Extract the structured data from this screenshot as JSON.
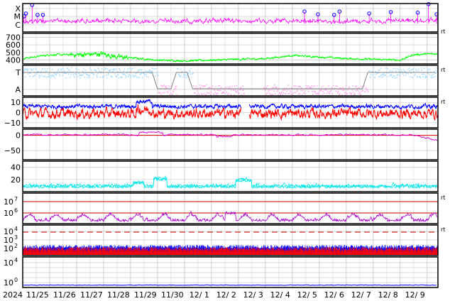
{
  "chart_data": {
    "type": "line",
    "x_axis": {
      "year_label": "2024",
      "dates": [
        "11/25",
        "11/26",
        "11/27",
        "11/28",
        "11/29",
        "11/30",
        "12/ 1",
        "12/ 2",
        "12/ 3",
        "12/ 4",
        "12/ 5",
        "12/ 6",
        "12/ 7",
        "12/ 8",
        "12/ 9"
      ]
    },
    "panels": [
      {
        "id": "xray_flares",
        "type": "line",
        "tick_labels": [
          "X",
          "M",
          "C"
        ],
        "colors": {
          "line": "#ff00ff",
          "markers": "#0000ff"
        },
        "flare_days": [
          0.05,
          0.12,
          0.35,
          0.55,
          0.75,
          10.45,
          10.95,
          11.55,
          11.75,
          12.85,
          13.65,
          14.65,
          15.05,
          15.35
        ],
        "flare_levels": [
          0.55,
          0.65,
          0.95,
          0.6,
          0.6,
          0.72,
          0.62,
          0.6,
          0.72,
          0.65,
          0.7,
          0.68,
          0.98,
          0.62
        ]
      },
      {
        "id": "solar_wind_speed",
        "type": "line",
        "tick_labels": [
          "700",
          "600",
          "500",
          "400"
        ],
        "ylim": [
          350,
          750
        ],
        "colors": {
          "line": "#00ff00"
        },
        "days": [
          0,
          1,
          2,
          3,
          3.5,
          4,
          5,
          6,
          7,
          8,
          9,
          10,
          11,
          12,
          13,
          14,
          14.5,
          15
        ],
        "values": [
          420,
          470,
          470,
          480,
          440,
          430,
          400,
          390,
          400,
          410,
          420,
          460,
          440,
          420,
          410,
          400,
          470,
          480
        ]
      },
      {
        "id": "sector_ta",
        "type": "line",
        "tick_labels": [
          "T",
          "A"
        ],
        "colors": {
          "toward": "#aaddff",
          "away": "#ffaaee",
          "state": "#808080"
        },
        "state_days": [
          0,
          4.8,
          5.0,
          5.5,
          5.7,
          6.1,
          6.3,
          12.6,
          12.8,
          15.3
        ],
        "state_values": [
          1,
          1,
          0,
          0,
          1,
          1,
          0,
          0,
          1,
          1
        ]
      },
      {
        "id": "imf_bz",
        "type": "line",
        "tick_labels": [
          "10",
          "0",
          "−10"
        ],
        "ylim": [
          -15,
          15
        ],
        "colors": {
          "bt": "#0000ff",
          "bz": "#ff0000"
        }
      },
      {
        "id": "dst",
        "type": "line",
        "tick_labels": [
          "0",
          "−50"
        ],
        "ylim": [
          -80,
          20
        ],
        "colors": {
          "line": "#dd00dd",
          "zero": "#cc0000"
        }
      },
      {
        "id": "ae",
        "type": "line",
        "tick_labels": [
          "40",
          "20"
        ],
        "ylim": [
          0,
          50
        ],
        "colors": {
          "line": "#00e6e6"
        }
      },
      {
        "id": "electron_flux",
        "type": "line",
        "tick_labels": [
          "10",
          "10"
        ],
        "tick_exponents": [
          "7",
          "6"
        ],
        "colors": {
          "line": "#aa00cc",
          "threshold": "#cc0000"
        }
      },
      {
        "id": "proton_flux",
        "type": "line",
        "tick_labels": [
          "10",
          "10",
          "10"
        ],
        "tick_exponents": [
          "4",
          "3",
          "2"
        ],
        "colors": {
          "p1": "#0000ff",
          "p2": "#ff0000",
          "threshold": "#cc0000"
        }
      },
      {
        "id": "high_energy",
        "type": "line",
        "tick_labels": [
          "10",
          "10"
        ],
        "tick_exponents": [
          "4",
          "0"
        ],
        "colors": {
          "line": "#0000ff"
        }
      }
    ]
  }
}
